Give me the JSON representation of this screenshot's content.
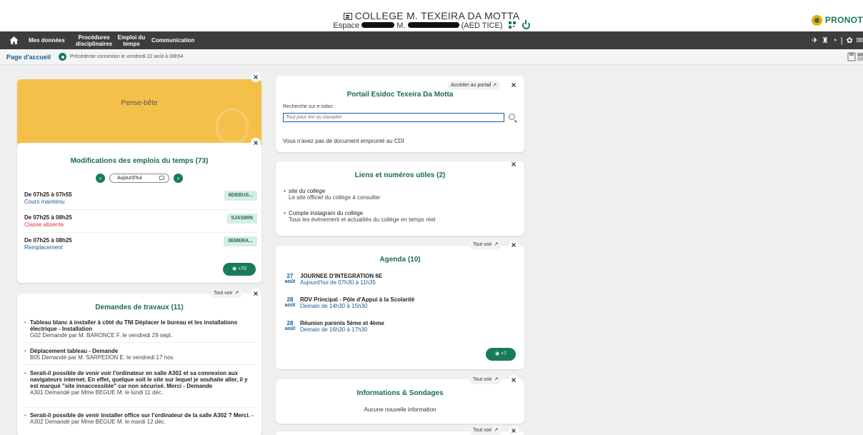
{
  "header": {
    "school_name": "COLLEGE M. TEXEIRA DA MOTTA",
    "espace_prefix": "Espace",
    "user_prefix": "M.",
    "role": "(AED TICE)",
    "brand": "PRONOT"
  },
  "nav": {
    "items": [
      {
        "label": "Mes données"
      },
      {
        "label": "Procédures disciplinaires"
      },
      {
        "label": "Emploi du temps"
      },
      {
        "label": "Communication"
      }
    ]
  },
  "breadcrumb": {
    "page": "Page d'accueil",
    "last_connection": "Précédente connexion le vendredi 22 août à 08h54"
  },
  "pense_bete": {
    "title": "Pense-bête"
  },
  "modifications": {
    "title": "Modifications des emplois du temps (73)",
    "date_label": "Aujourd'hui",
    "more_label": "+70",
    "rows": [
      {
        "time": "De 07h25 à 07h55",
        "status": "Cours maintenu",
        "status_color": "#1a5c96",
        "class": "6DEBUS..."
      },
      {
        "time": "De 07h25 à 08h25",
        "status": "Classe absente",
        "status_color": "#d9363e",
        "class": "5JASMIN"
      },
      {
        "time": "De 07h25 à 08h25",
        "status": "Remplacement",
        "status_color": "#1a5c96",
        "class": "3EMERA..."
      }
    ]
  },
  "demandes": {
    "title": "Demandes de travaux (11)",
    "tout_voir": "Tout voir",
    "items": [
      {
        "title": "Tableau blanc à installer à côté du TNI Déplacer le bureau et les installations électrique - Installation",
        "sub": "G02 Demandé par M. BARONCE F. le vendredi 29 sept."
      },
      {
        "title": "Déplacement tableau - Demande",
        "sub": "B05 Demandé par M. SARPEDON E. le vendredi 17 nov."
      },
      {
        "title": "Serait-il possible de venir voir l'ordinateur en salle A301 et sa connexion aux navigateurs internet. En effet, quelque soit le site sur lequel je souhaite aller, il y est marqué \"site innaccessible\" car non sécurisé. Merci - Demande",
        "sub": "A301 Demandé par Mme BEGUE M. le lundi 11 déc."
      },
      {
        "title": "Serait-il possible de venir installer office sur l'ordinateur de la salle A302 ? Merci. -",
        "sub": "A302 Demandé par Mme BEGUE M. le mardi 12 déc."
      }
    ]
  },
  "esidoc": {
    "title": "Portail Esidoc Texeira Da Motta",
    "portal_label": "Accéder au portail",
    "search_label": "Recherche sur e-sidoc",
    "search_placeholder": "Tout pour lire ou travailler",
    "message": "Vous n'avez pas de document emprunté au CDI"
  },
  "liens": {
    "title": "Liens et numéros utiles (2)",
    "items": [
      {
        "title": "site du collège",
        "desc": "Le site officiel du collège à consulter"
      },
      {
        "title": "Compte instagram du collège",
        "desc": "Tous les évènement et actualités du collège en temps réel"
      }
    ]
  },
  "agenda": {
    "title": "Agenda (10)",
    "tout_voir": "Tout voir",
    "more_label": "+7",
    "items": [
      {
        "day": "27",
        "month": "août",
        "title": "JOURNEE D'INTEGRATION 6E",
        "time": "Aujourd'hui de 07h30 à 11h35"
      },
      {
        "day": "28",
        "month": "août",
        "title": "RDV Principal - Pôle d'Appui à la Scolarité",
        "time": "Demain de 14h30 à 15h30"
      },
      {
        "day": "28",
        "month": "août",
        "title": "Réunion parents 5ème et 4ème",
        "time": "Demain de 16h30 à 17h30"
      }
    ]
  },
  "infos": {
    "title": "Informations & Sondages",
    "tout_voir": "Tout voir",
    "message": "Aucune nouvelle information"
  },
  "bottom_card": {
    "tout_voir": "Tout voir"
  },
  "colors": {
    "accent": "#1a7a5e",
    "nav_bg": "#3d3d3d",
    "pense_bete": "#f5c04a",
    "arrow": "#e0242f"
  }
}
